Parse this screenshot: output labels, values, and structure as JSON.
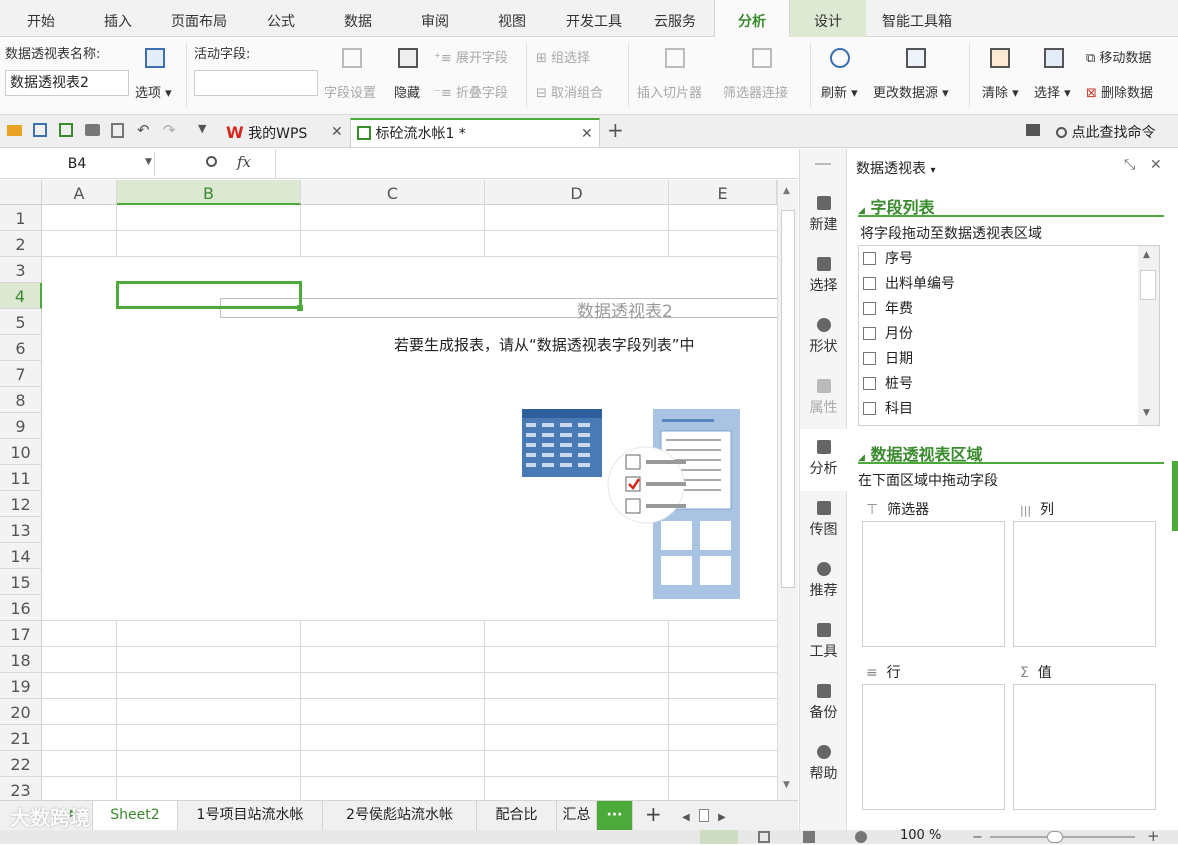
{
  "ribbon_tabs": [
    "开始",
    "插入",
    "页面布局",
    "公式",
    "数据",
    "审阅",
    "视图",
    "开发工具",
    "云服务",
    "分析",
    "设计",
    "智能工具箱"
  ],
  "ribbon": {
    "pivot_name_label": "数据透视表名称:",
    "pivot_name_value": "数据透视表2",
    "options": "选项",
    "active_field_label": "活动字段:",
    "active_field_value": "",
    "field_settings": "字段设置",
    "hide": "隐藏",
    "expand_field": "展开字段",
    "collapse_field": "折叠字段",
    "group_selection": "组选择",
    "ungroup": "取消组合",
    "insert_slicer": "插入切片器",
    "filter_connections": "筛选器连接",
    "refresh": "刷新",
    "change_source": "更改数据源",
    "clear": "清除",
    "select": "选择",
    "move_pivot": "移动数据",
    "delete_pivot": "删除数据"
  },
  "quick_access": {
    "my_wps_tab": "我的WPS",
    "doc_tab": "标砼流水帐1 *",
    "search_label": "点此查找命令"
  },
  "formula_bar": {
    "name_box": "B4",
    "fx": "fx",
    "content": ""
  },
  "grid": {
    "columns": [
      "A",
      "B",
      "C",
      "D",
      "E"
    ],
    "rows": [
      "1",
      "2",
      "3",
      "4",
      "5",
      "6",
      "7",
      "8",
      "9",
      "10",
      "11",
      "12",
      "13",
      "14",
      "15",
      "16",
      "17",
      "18",
      "19",
      "20",
      "21",
      "22",
      "23"
    ],
    "selected_column": "B",
    "selected_row": "4",
    "pivot_title": "数据透视表2",
    "pivot_hint": "若要生成报表，请从“数据透视表字段列表”中"
  },
  "sidebar": [
    "新建",
    "选择",
    "形状",
    "属性",
    "分析",
    "传图",
    "推荐",
    "工具",
    "备份",
    "帮助"
  ],
  "panel": {
    "title": "数据透视表",
    "field_list_heading": "字段列表",
    "field_list_hint": "将字段拖动至数据透视表区域",
    "fields": [
      "序号",
      "出料单编号",
      "年费",
      "月份",
      "日期",
      "桩号",
      "科目"
    ],
    "areas_heading": "数据透视表区域",
    "areas_hint": "在下面区域中拖动字段",
    "filter_label": "筛选器",
    "column_label": "列",
    "row_label": "行",
    "value_label": "值",
    "filter_icon_glyph": "⊤",
    "column_icon_glyph": "|||",
    "row_icon_glyph": "≡",
    "value_icon_glyph": "Σ"
  },
  "sheet_tabs": [
    "Sheet2",
    "1号项目站流水帐",
    "2号侯彪站流水帐",
    "配合比",
    "汇总"
  ],
  "more_sheets": "···",
  "add_sheet": "+",
  "status": {
    "zoom": "100 %",
    "watermark": "大数跨境"
  },
  "colors": {
    "accent_green": "#3a8a2e",
    "selection_green": "#4caa3a",
    "wps_red": "#d7261e"
  }
}
